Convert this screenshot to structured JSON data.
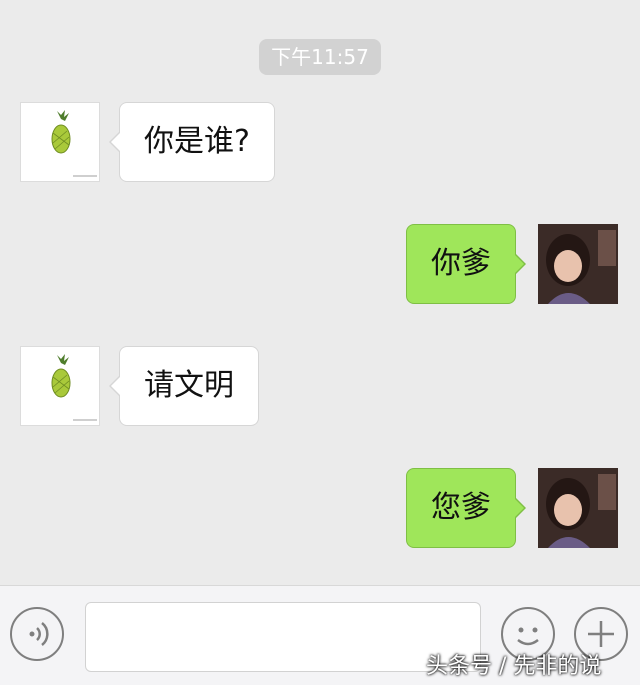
{
  "timestamp": "下午11:57",
  "messages": [
    {
      "side": "left",
      "text": "你是谁?"
    },
    {
      "side": "right",
      "text": "你爹"
    },
    {
      "side": "left",
      "text": "请文明"
    },
    {
      "side": "right",
      "text": "您爹"
    }
  ],
  "avatars": {
    "left_icon": "pineapple-icon",
    "right_icon": "user-photo"
  },
  "colors": {
    "background": "#ebebeb",
    "sent_bubble": "#9fe65a",
    "received_bubble": "#ffffff",
    "timestamp_bg": "#d2d2d2"
  },
  "input_bar": {
    "voice_icon": "voice-icon",
    "emoji_icon": "emoji-icon",
    "plus_icon": "plus-icon",
    "text_value": ""
  },
  "watermark": "头条号 / 先非的说"
}
